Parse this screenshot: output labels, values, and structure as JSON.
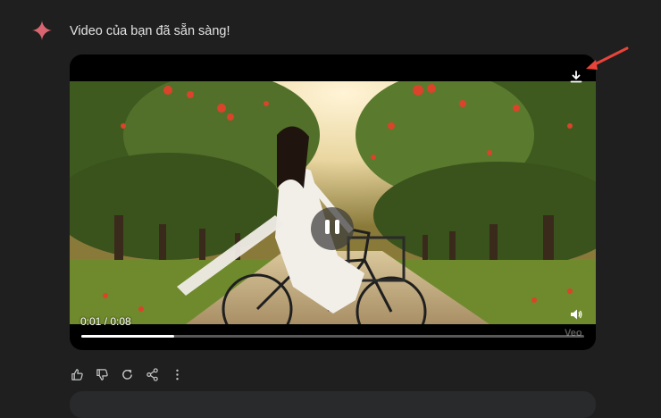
{
  "message": {
    "text": "Video của bạn đã sẵn sàng!"
  },
  "player": {
    "time_display": "0:01 / 0:08",
    "progress_fraction": 0.185,
    "watermark": "Veo",
    "state": "playing"
  },
  "icons": {
    "sparkle": "gemini-sparkle-icon",
    "download": "download-icon",
    "pause": "pause-icon",
    "volume": "volume-icon",
    "like": "thumbs-up-icon",
    "dislike": "thumbs-down-icon",
    "regenerate": "refresh-icon",
    "share": "share-icon",
    "more": "more-vert-icon"
  },
  "colors": {
    "background": "#1f1f1f",
    "text": "#e3e3e3",
    "sparkle": "#d96570",
    "annotation_arrow": "#e8443a"
  }
}
